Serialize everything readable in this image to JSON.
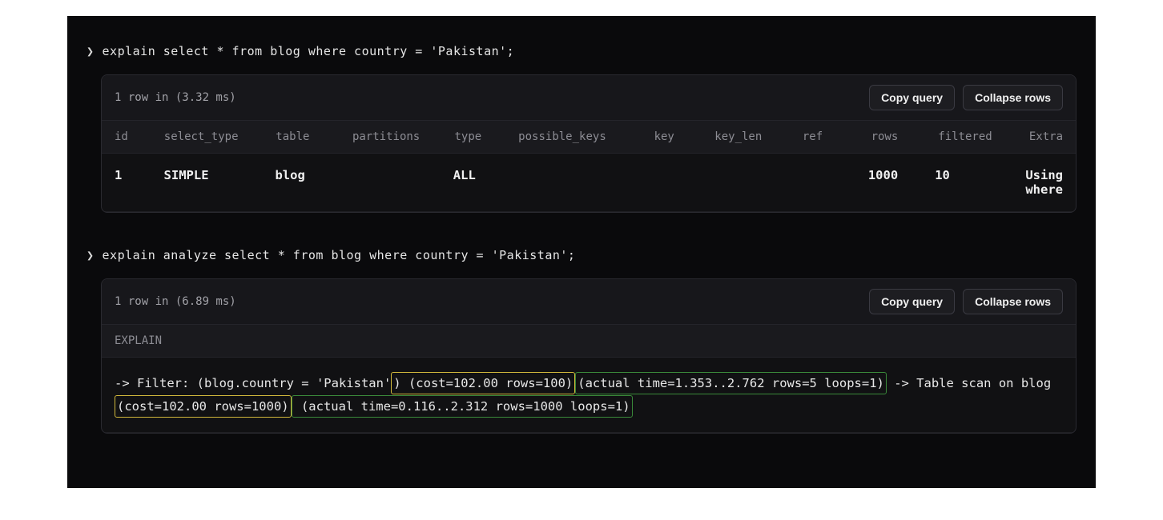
{
  "queries": [
    {
      "prompt": "❯",
      "sql": "explain select * from blog where country = 'Pakistan';",
      "row_summary": "1 row in (3.32 ms)",
      "copy_label": "Copy query",
      "collapse_label": "Collapse rows",
      "columns": [
        "id",
        "select_type",
        "table",
        "partitions",
        "type",
        "possible_keys",
        "key",
        "key_len",
        "ref",
        "rows",
        "filtered",
        "Extra"
      ],
      "row": {
        "id": "1",
        "select_type": "SIMPLE",
        "table": "blog",
        "partitions": "",
        "type": "ALL",
        "possible_keys": "",
        "key": "",
        "key_len": "",
        "ref": "",
        "rows": "1000",
        "filtered": "10",
        "Extra": "Using where"
      }
    },
    {
      "prompt": "❯",
      "sql": "explain analyze select * from blog where country = 'Pakistan';",
      "row_summary": "1 row in (6.89 ms)",
      "copy_label": "Copy query",
      "collapse_label": "Collapse rows",
      "explain_label": "EXPLAIN",
      "explain_output": {
        "p1": "-> Filter: (blog.country = 'Pakistan'",
        "p2_yellow": ") (cost=102.00 rows=100)",
        "p3_green": "(actual time=1.353..2.762 rows=5 loops=1)",
        "p4": " -> Table scan on blog ",
        "p5_yellow": "(cost=102.00 rows=1000)",
        "p6_green": " (actual time=0.116..2.312 rows=1000 loops=1)"
      }
    }
  ]
}
